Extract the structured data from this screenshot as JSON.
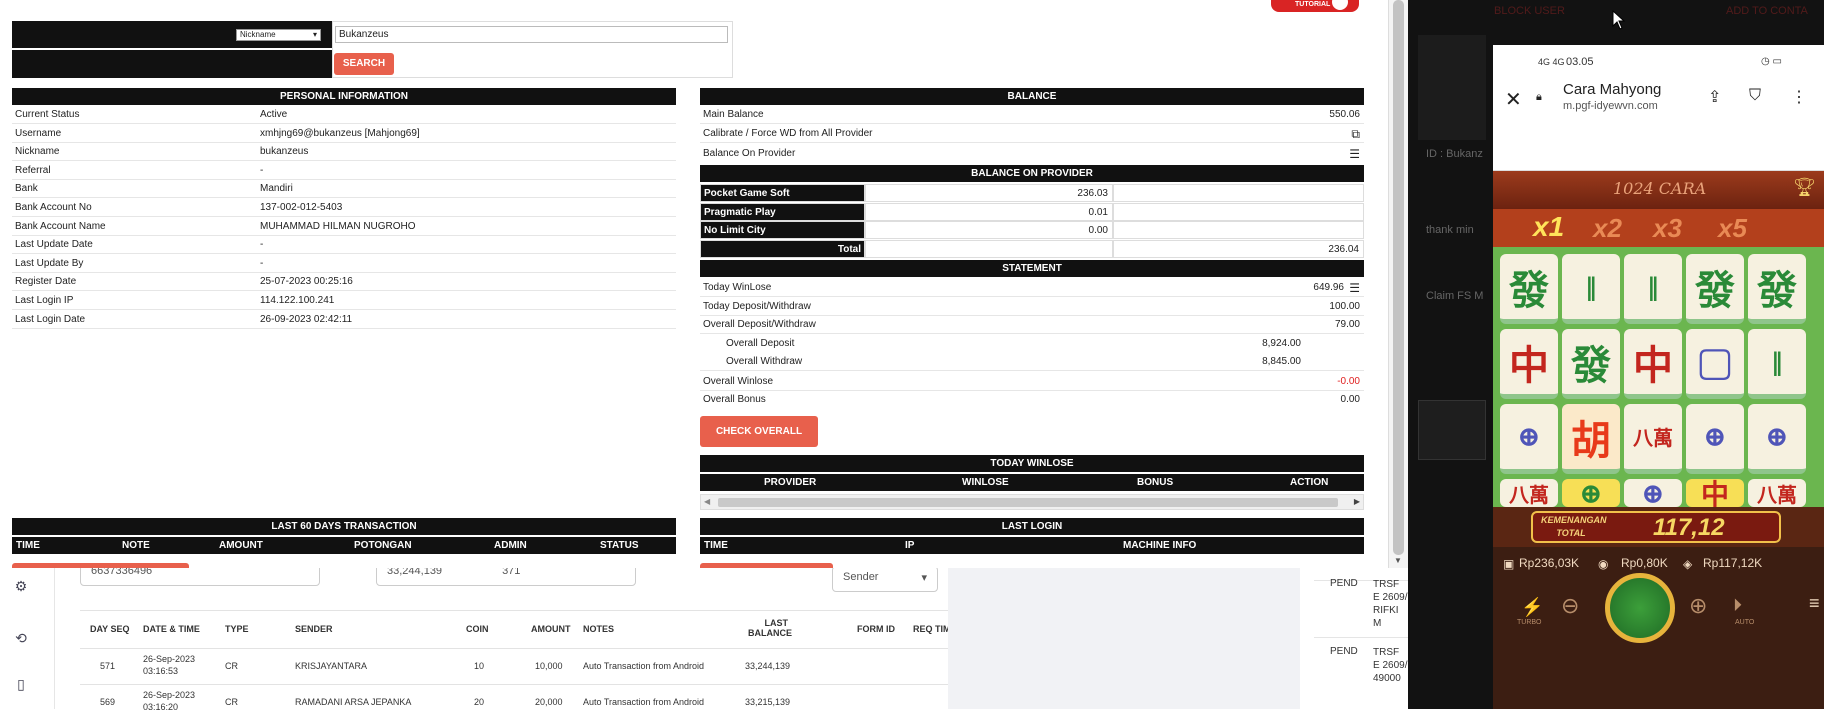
{
  "search": {
    "select_value": "Nickname",
    "input_value": "Bukanzeus",
    "button": "SEARCH"
  },
  "tutorials": "TUTORIALS",
  "personal": {
    "title": "PERSONAL INFORMATION",
    "rows": [
      {
        "label": "Current Status",
        "value": "Active"
      },
      {
        "label": "Username",
        "value": "xmhjng69@bukanzeus  [Mahjong69]"
      },
      {
        "label": "Nickname",
        "value": "bukanzeus"
      },
      {
        "label": "Referral",
        "value": "-"
      },
      {
        "label": "Bank",
        "value": "Mandiri"
      },
      {
        "label": "Bank Account No",
        "value": "137-002-012-5403"
      },
      {
        "label": "Bank Account Name",
        "value": "MUHAMMAD HILMAN NUGROHO"
      },
      {
        "label": "Last Update Date",
        "value": "-"
      },
      {
        "label": "Last Update By",
        "value": "-"
      },
      {
        "label": "Register Date",
        "value": "25-07-2023 00:25:16"
      },
      {
        "label": "Last Login IP",
        "value": "114.122.100.241"
      },
      {
        "label": "Last Login Date",
        "value": "26-09-2023 02:42:11"
      }
    ]
  },
  "balance": {
    "title": "BALANCE",
    "main_label": "Main Balance",
    "main_value": "550.06",
    "calibrate": "Calibrate / Force WD from All Provider",
    "on_provider": "Balance On Provider"
  },
  "provider": {
    "title": "BALANCE ON PROVIDER",
    "rows": [
      {
        "name": "Pocket Game Soft",
        "value": "236.03"
      },
      {
        "name": "Pragmatic Play",
        "value": "0.01"
      },
      {
        "name": "No Limit City",
        "value": "0.00"
      }
    ],
    "total_label": "Total",
    "total_value": "236.04"
  },
  "statement": {
    "title": "STATEMENT",
    "today_winlose": {
      "label": "Today WinLose",
      "value": "649.96"
    },
    "today_dw": {
      "label": "Today Deposit/Withdraw",
      "value": "100.00"
    },
    "overall_dw": {
      "label": "Overall Deposit/Withdraw",
      "value": "79.00"
    },
    "overall_dep": {
      "label": "Overall Deposit",
      "value": "8,924.00"
    },
    "overall_wd": {
      "label": "Overall Withdraw",
      "value": "8,845.00"
    },
    "overall_winlose": {
      "label": "Overall Winlose",
      "value": "-0.00"
    },
    "overall_bonus": {
      "label": "Overall Bonus",
      "value": "0.00"
    },
    "check_button": "CHECK OVERALL"
  },
  "today_winlose": {
    "title": "TODAY WINLOSE",
    "cols": [
      "PROVIDER",
      "WINLOSE",
      "BONUS",
      "ACTION"
    ]
  },
  "last60": {
    "title": "LAST 60 DAYS TRANSACTION",
    "cols": [
      "TIME",
      "NOTE",
      "AMOUNT",
      "POTONGAN",
      "ADMIN",
      "STATUS"
    ]
  },
  "last_login": {
    "title": "LAST LOGIN",
    "cols": [
      "TIME",
      "IP",
      "MACHINE INFO"
    ]
  },
  "back": {
    "input1": "6637336496",
    "input2": "33,244,139",
    "input3": "371",
    "sender_select": "Sender",
    "cols": [
      "DAY SEQ",
      "DATE & TIME",
      "TYPE",
      "SENDER",
      "COIN",
      "AMOUNT",
      "NOTES",
      "LAST BALANCE",
      "FORM ID",
      "REQ TIM"
    ],
    "rows": [
      {
        "seq": "571",
        "date": "26-Sep-2023",
        "time": "03:16:53",
        "type": "CR",
        "sender": "KRISJAYANTARA",
        "coin": "10",
        "amount": "10,000",
        "notes": "Auto Transaction from Android",
        "balance": "33,244,139"
      },
      {
        "seq": "569",
        "date": "26-Sep-2023",
        "time": "03:16:20",
        "type": "CR",
        "sender": "RAMADANI ARSA JEPANKA",
        "coin": "20",
        "amount": "20,000",
        "notes": "Auto Transaction from Android",
        "balance": "33,215,139"
      }
    ],
    "pend1": "PEND",
    "pend1_text": "TRSF E 2609/ RIFKI M",
    "pend2": "PEND",
    "pend2_text": "TRSF E 2609/ 49000"
  },
  "chat": {
    "block_user": "BLOCK USER",
    "add_contact": "ADD TO CONTA",
    "id_line": "ID : Bukanz",
    "msg1": "thank min",
    "msg2": "Claim FS M"
  },
  "phone": {
    "status_time": "03.05",
    "status_net": "4G 4G",
    "page_title": "Cara Mahyong",
    "page_url": "m.pgf-idyewvn.com",
    "game_banner": "1024 CARA",
    "multipliers": [
      "x1",
      "x2",
      "x3",
      "x5"
    ],
    "win_label": "KEMENANGAN TOTAL",
    "win_value": "117,12",
    "balance": "Rp236,03K",
    "bet": "Rp0,80K",
    "win": "Rp117,12K",
    "turbo": "TURBO",
    "auto": "AUTO"
  },
  "tiles": [
    [
      "發",
      "𝄁",
      "𝄁",
      "發",
      "發"
    ],
    [
      "中",
      "發",
      "中",
      "▢",
      "𝄁"
    ],
    [
      "⊕",
      "胡",
      "八萬",
      "⊕",
      "⊕"
    ],
    [
      "八萬",
      "⊕",
      "⊕",
      "中",
      "八萬"
    ]
  ],
  "colors": {
    "accent": "#e8604c",
    "header": "#111111",
    "negative": "#e02020"
  }
}
